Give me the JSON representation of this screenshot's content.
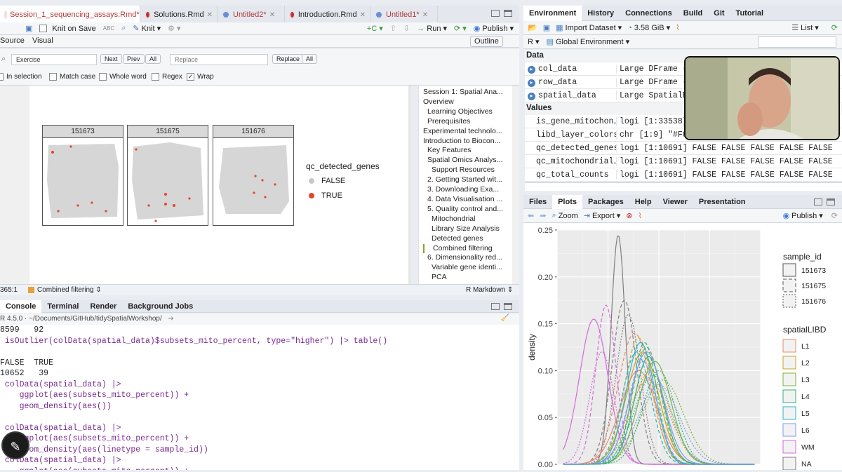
{
  "editor": {
    "tabs": [
      {
        "label": "Session_1_sequencing_assays.Rmd*",
        "active": true
      },
      {
        "label": "Solutions.Rmd",
        "active": false
      },
      {
        "label": "Untitled2*",
        "active": false
      },
      {
        "label": "Introduction.Rmd",
        "active": false
      },
      {
        "label": "Untitled1*",
        "active": false
      }
    ],
    "toolbar": {
      "knit_on_save": "Knit on Save",
      "knit": "Knit",
      "run": "Run",
      "publish": "Publish"
    },
    "mode_tabs": {
      "source": "Source",
      "visual": "Visual",
      "outline": "Outline"
    },
    "find": {
      "search_value": "Exercise",
      "next": "Next",
      "prev": "Prev",
      "all": "All",
      "replace_placeholder": "Replace",
      "replace": "Replace",
      "replace_all": "All",
      "in_selection": "In selection",
      "match_case": "Match case",
      "whole_word": "Whole word",
      "regex": "Regex",
      "wrap": "Wrap"
    },
    "plot": {
      "facets": [
        "151673",
        "151675",
        "151676"
      ],
      "legend_title": "qc_detected_genes",
      "legend_items": [
        {
          "label": "FALSE",
          "color": "#c8c8c8"
        },
        {
          "label": "TRUE",
          "color": "#e8442a"
        }
      ]
    },
    "outline": [
      "Session 1: Spatial Ana...",
      "Overview",
      "Learning Objectives",
      "Prerequisites",
      "Experimental technolo...",
      "Introduction to Biocon...",
      "Key Features",
      "Spatial Omics Analys...",
      "Support Resources",
      "2. Getting Started wit...",
      "3. Downloading Exa...",
      "4. Data Visualisation ...",
      "5. Quality control and...",
      "Mitochondrial",
      "Library Size Analysis",
      "Detected genes",
      "Combined filtering",
      "6. Dimensionality red...",
      "Variable gene identi...",
      "PCA"
    ],
    "status": {
      "position": "365:1",
      "section": "Combined filtering",
      "mode": "R Markdown"
    }
  },
  "console": {
    "tabs": [
      "Console",
      "Terminal",
      "Render",
      "Background Jobs"
    ],
    "path": "R 4.5.0 · ~/Documents/GitHub/tidySpatialWorkshop/",
    "lines": [
      {
        "text": "8599   92",
        "purple": false
      },
      {
        "text": " isOutlier(colData(spatial_data)$subsets_mito_percent, type=\"higher\") |> table()",
        "purple": true
      },
      {
        "text": "",
        "purple": false
      },
      {
        "text": "FALSE  TRUE",
        "purple": false
      },
      {
        "text": "10652   39",
        "purple": false
      },
      {
        "text": " colData(spatial_data) |>",
        "purple": true
      },
      {
        "text": "    ggplot(aes(subsets_mito_percent)) +",
        "purple": true
      },
      {
        "text": "    geom_density(aes())",
        "purple": true
      },
      {
        "text": "",
        "purple": false
      },
      {
        "text": " colData(spatial_data) |>",
        "purple": true
      },
      {
        "text": "    ggplot(aes(subsets_mito_percent)) +",
        "purple": true
      },
      {
        "text": "    geom_density(aes(linetype = sample_id))",
        "purple": true
      },
      {
        "text": " colData(spatial_data) |>",
        "purple": true
      },
      {
        "text": "    ggplot(aes(subsets_mito_percent)) +",
        "purple": true
      }
    ]
  },
  "environment": {
    "tabs": [
      "Environment",
      "History",
      "Connections",
      "Build",
      "Git",
      "Tutorial"
    ],
    "import_dataset": "Import Dataset",
    "memory": "3.58 GiB",
    "view": "List",
    "language": "R",
    "scope": "Global Environment",
    "data_header": "Data",
    "values_header": "Values",
    "data": [
      {
        "name": "col_data",
        "value": "Large DFrame (6"
      },
      {
        "name": "row_data",
        "value": "Large DFrame (9"
      },
      {
        "name": "spatial_data",
        "value": "Large SpatialEx"
      }
    ],
    "values": [
      {
        "name": "is_gene_mitochon…",
        "value": "logi [1:33538]"
      },
      {
        "name": "libd_layer_colors",
        "value": "chr [1:9] \"#F00"
      },
      {
        "name": "qc_detected_genes",
        "value": "logi [1:10691] FALSE FALSE FALSE FALSE FALSE"
      },
      {
        "name": "qc_mitochondrial…",
        "value": "logi [1:10691] FALSE FALSE FALSE FALSE FALSE"
      },
      {
        "name": "qc_total_counts",
        "value": "logi [1:10691] FALSE FALSE FALSE FALSE FALSE"
      }
    ]
  },
  "files": {
    "tabs": [
      "Files",
      "Plots",
      "Packages",
      "Help",
      "Viewer",
      "Presentation"
    ],
    "zoom": "Zoom",
    "export": "Export",
    "publish": "Publish"
  },
  "chart_data": {
    "type": "line",
    "ylabel": "density",
    "ylim": [
      0,
      0.25
    ],
    "y_ticks": [
      "0.00",
      "0.05",
      "0.10",
      "0.15",
      "0.20",
      "0.25"
    ],
    "legend_sample_title": "sample_id",
    "samples": [
      {
        "name": "151673",
        "dash": ""
      },
      {
        "name": "151675",
        "dash": "5,3"
      },
      {
        "name": "151676",
        "dash": "2,2"
      }
    ],
    "legend_layer_title": "spatialLIBD",
    "layers": [
      {
        "name": "L1",
        "color": "#e8896e"
      },
      {
        "name": "L2",
        "color": "#c9a227"
      },
      {
        "name": "L3",
        "color": "#7fb23a"
      },
      {
        "name": "L4",
        "color": "#35b07a"
      },
      {
        "name": "L5",
        "color": "#2bb4c8"
      },
      {
        "name": "L6",
        "color": "#7a9ef0"
      },
      {
        "name": "WM",
        "color": "#d46ad8"
      },
      {
        "name": "NA",
        "color": "#7f7f7f"
      }
    ],
    "series": [
      {
        "sample": 0,
        "layer": 7,
        "peak": 0.245,
        "mu": 0.3,
        "sd": 0.035
      },
      {
        "sample": 1,
        "layer": 7,
        "peak": 0.175,
        "mu": 0.33,
        "sd": 0.06
      },
      {
        "sample": 2,
        "layer": 7,
        "peak": 0.16,
        "mu": 0.35,
        "sd": 0.06
      },
      {
        "sample": 0,
        "layer": 6,
        "peak": 0.155,
        "mu": 0.18,
        "sd": 0.07
      },
      {
        "sample": 1,
        "layer": 6,
        "peak": 0.17,
        "mu": 0.24,
        "sd": 0.05
      },
      {
        "sample": 2,
        "layer": 6,
        "peak": 0.12,
        "mu": 0.22,
        "sd": 0.06
      },
      {
        "sample": 0,
        "layer": 0,
        "peak": 0.1,
        "mu": 0.4,
        "sd": 0.09
      },
      {
        "sample": 1,
        "layer": 0,
        "peak": 0.14,
        "mu": 0.38,
        "sd": 0.08
      },
      {
        "sample": 2,
        "layer": 0,
        "peak": 0.09,
        "mu": 0.45,
        "sd": 0.1
      },
      {
        "sample": 0,
        "layer": 1,
        "peak": 0.12,
        "mu": 0.42,
        "sd": 0.08
      },
      {
        "sample": 1,
        "layer": 1,
        "peak": 0.135,
        "mu": 0.4,
        "sd": 0.07
      },
      {
        "sample": 2,
        "layer": 1,
        "peak": 0.1,
        "mu": 0.46,
        "sd": 0.09
      },
      {
        "sample": 0,
        "layer": 2,
        "peak": 0.11,
        "mu": 0.48,
        "sd": 0.08
      },
      {
        "sample": 1,
        "layer": 2,
        "peak": 0.125,
        "mu": 0.44,
        "sd": 0.07
      },
      {
        "sample": 2,
        "layer": 2,
        "peak": 0.09,
        "mu": 0.52,
        "sd": 0.1
      },
      {
        "sample": 0,
        "layer": 3,
        "peak": 0.115,
        "mu": 0.45,
        "sd": 0.07
      },
      {
        "sample": 1,
        "layer": 3,
        "peak": 0.13,
        "mu": 0.43,
        "sd": 0.06
      },
      {
        "sample": 2,
        "layer": 3,
        "peak": 0.1,
        "mu": 0.5,
        "sd": 0.08
      },
      {
        "sample": 0,
        "layer": 4,
        "peak": 0.13,
        "mu": 0.41,
        "sd": 0.07
      },
      {
        "sample": 1,
        "layer": 4,
        "peak": 0.12,
        "mu": 0.39,
        "sd": 0.07
      },
      {
        "sample": 2,
        "layer": 4,
        "peak": 0.095,
        "mu": 0.47,
        "sd": 0.09
      },
      {
        "sample": 0,
        "layer": 5,
        "peak": 0.12,
        "mu": 0.44,
        "sd": 0.08
      },
      {
        "sample": 1,
        "layer": 5,
        "peak": 0.11,
        "mu": 0.42,
        "sd": 0.07
      },
      {
        "sample": 2,
        "layer": 5,
        "peak": 0.085,
        "mu": 0.5,
        "sd": 0.1
      }
    ]
  }
}
